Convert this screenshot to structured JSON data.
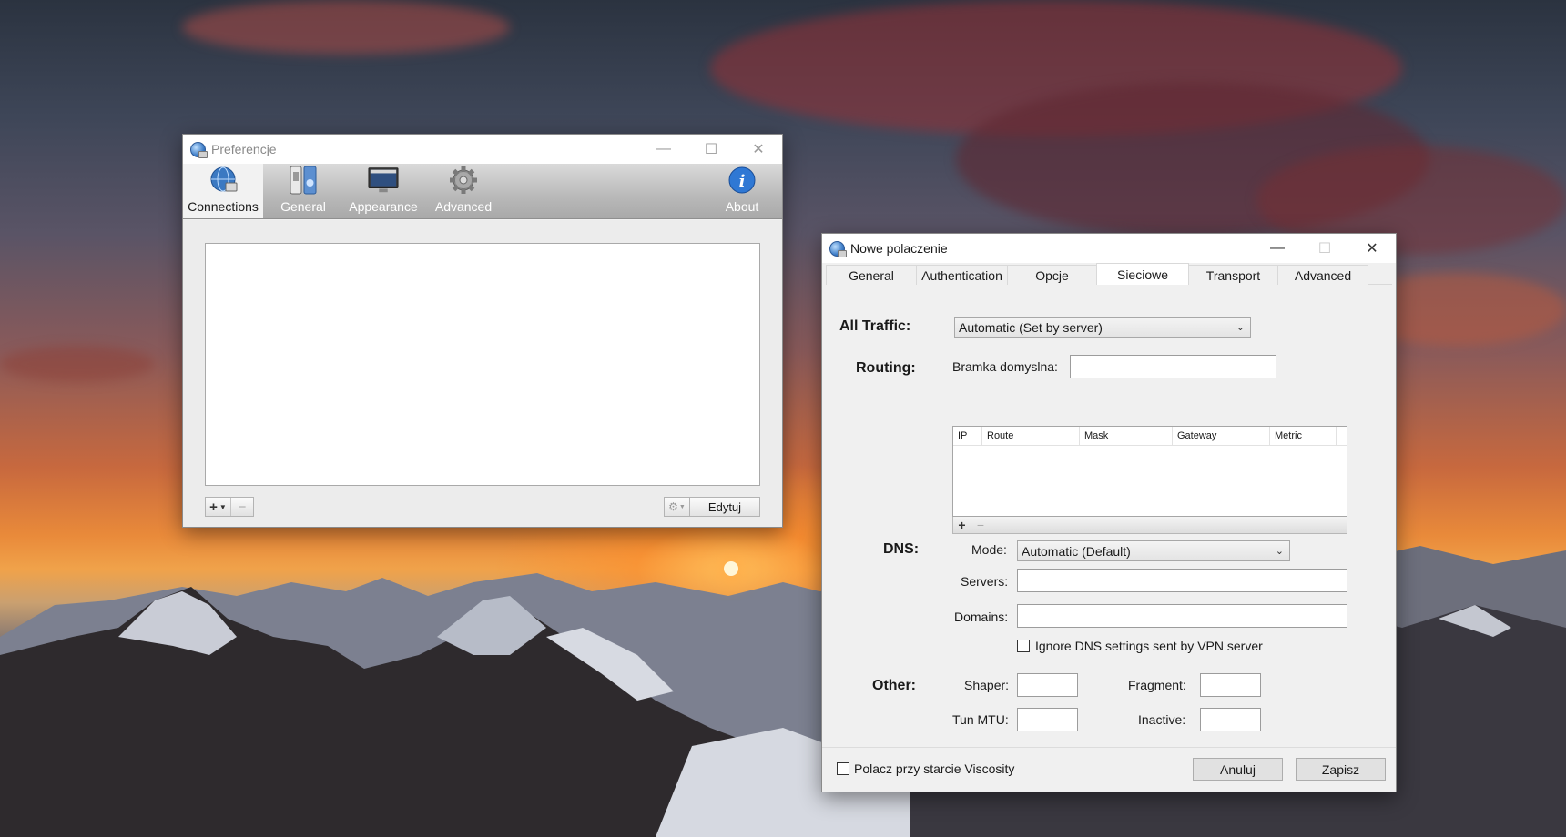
{
  "prefs_window": {
    "title": "Preferencje",
    "toolbar": [
      {
        "label": "Connections",
        "icon": "globe-icon",
        "active": true
      },
      {
        "label": "General",
        "icon": "switch-icon",
        "active": false
      },
      {
        "label": "Appearance",
        "icon": "monitor-icon",
        "active": false
      },
      {
        "label": "Advanced",
        "icon": "gear-icon",
        "active": false
      }
    ],
    "about_label": "About",
    "edit_button": "Edytuj"
  },
  "conn_window": {
    "title": "Nowe polaczenie",
    "tabs": [
      "General",
      "Authentication",
      "Opcje",
      "Sieciowe",
      "Transport",
      "Advanced"
    ],
    "active_tab": "Sieciowe",
    "all_traffic": {
      "label": "All Traffic:",
      "value": "Automatic (Set by server)"
    },
    "routing": {
      "label": "Routing:",
      "gateway_label": "Bramka domyslna:",
      "gateway_value": "",
      "columns": [
        "IP",
        "Route",
        "Mask",
        "Gateway",
        "Metric"
      ]
    },
    "dns": {
      "label": "DNS:",
      "mode_label": "Mode:",
      "mode_value": "Automatic (Default)",
      "servers_label": "Servers:",
      "servers_value": "",
      "domains_label": "Domains:",
      "domains_value": "",
      "ignore_label": "Ignore DNS settings sent by VPN server",
      "ignore_checked": false
    },
    "other": {
      "label": "Other:",
      "shaper_label": "Shaper:",
      "fragment_label": "Fragment:",
      "tun_mtu_label": "Tun MTU:",
      "inactive_label": "Inactive:"
    },
    "footer": {
      "startup_label": "Polacz przy starcie Viscosity",
      "startup_checked": false,
      "cancel_label": "Anuluj",
      "save_label": "Zapisz"
    }
  }
}
